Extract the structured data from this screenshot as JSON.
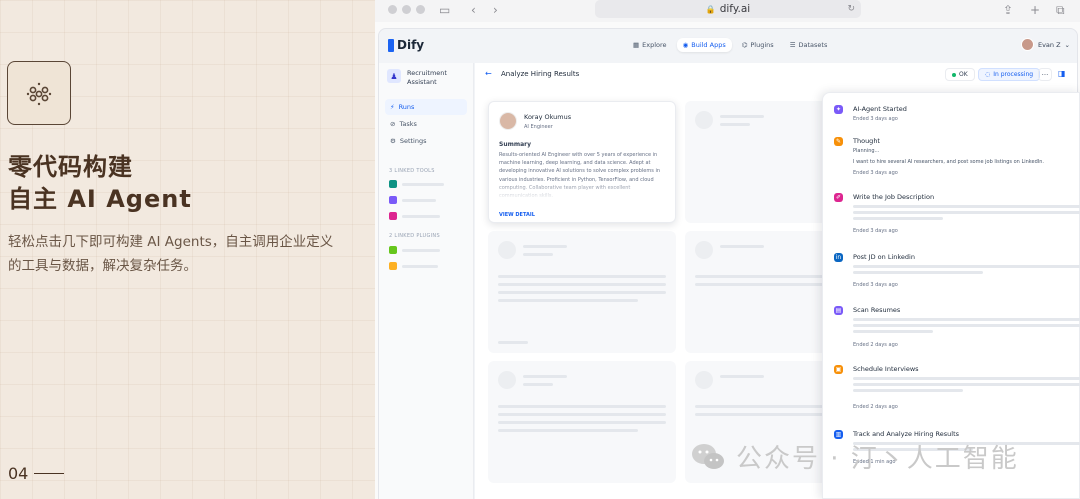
{
  "promo": {
    "title_line1": "零代码构建",
    "title_line2": "自主 AI Agent",
    "description": "轻松点击几下即可构建 AI Agents，自主调用企业定义的工具与数据，解决复杂任务。",
    "page_number": "04"
  },
  "browser": {
    "url": "dify.ai"
  },
  "app": {
    "logo": "Dify",
    "nav": [
      "Explore",
      "Build Apps",
      "Plugins",
      "Datasets"
    ],
    "active_nav": "Build Apps",
    "user_name": "Evan Z"
  },
  "sidebar": {
    "app_name": "Recruitment Assistant",
    "items": [
      {
        "label": "Runs",
        "icon": "lightning-icon"
      },
      {
        "label": "Tasks",
        "icon": "tasks-icon"
      },
      {
        "label": "Settings",
        "icon": "gear-icon"
      }
    ],
    "tools_heading": "3 LINKED TOOLS",
    "plugins_heading": "2 LINKED PLUGINS"
  },
  "main": {
    "title": "Analyze Hiring Results",
    "ok_label": "OK",
    "processing_label": "In processing",
    "more_label": "···"
  },
  "candidate": {
    "name": "Koray Okumus",
    "role": "AI Engineer",
    "summary_label": "Summary",
    "summary": "Results-oriented AI Engineer with over 5 years of experience in machine learning, deep learning, and data science. Adept at developing innovative AI solutions to solve complex problems in various industries. Proficient in Python, TensorFlow, and cloud computing. Collaborative team player with excellent communication skills.",
    "view_detail": "VIEW DETAIL"
  },
  "timeline": [
    {
      "title": "AI-Agent Started",
      "time": "Ended 3 days ago",
      "color": "#7a5af8",
      "icon": "agent-icon"
    },
    {
      "title": "Thought",
      "sub": "Planning...",
      "text": "I want to hire several AI researchers, and post some job listings on LinkedIn.",
      "time": "Ended 3 days ago",
      "color": "#f79009",
      "icon": "thought-icon"
    },
    {
      "title": "Write the Job Description",
      "time": "Ended 3 days ago",
      "color": "#dd2590",
      "icon": "pen-icon"
    },
    {
      "title": "Post JD on Linkedin",
      "time": "Ended 3 days ago",
      "color": "#0a66c2",
      "icon": "linkedin-icon"
    },
    {
      "title": "Scan Resumes",
      "time": "Ended 2 days ago",
      "color": "#7a5af8",
      "icon": "document-icon"
    },
    {
      "title": "Schedule Interviews",
      "time": "Ended 2 days ago",
      "color": "#f79009",
      "icon": "calendar-icon"
    },
    {
      "title": "Track and Analyze Hiring Results",
      "time": "Ended 1 min ago",
      "color": "#155eef",
      "icon": "chart-icon"
    }
  ],
  "watermark": "公众号 · 汀丶人工智能"
}
